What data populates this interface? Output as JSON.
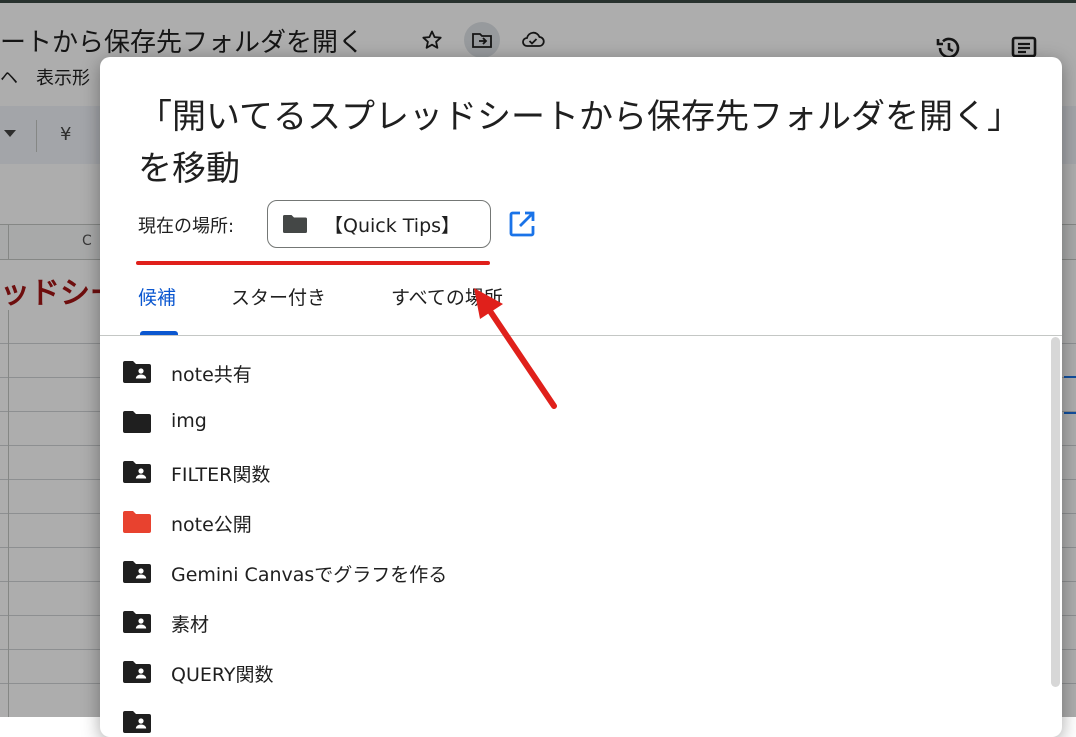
{
  "background": {
    "doc_title": "ートから保存先フォルダを開く",
    "menu_partial": "ヘ　表示形",
    "toolbar_symbol": "¥",
    "column_c": "C",
    "sheet_text": "ッドシー"
  },
  "dialog": {
    "title": "「開いてるスプレッドシートから保存先フォルダを開く」を移動",
    "current_location_label": "現在の場所:",
    "current_location_value": "【Quick Tips】",
    "tabs": [
      {
        "label": "候補"
      },
      {
        "label": "スター付き"
      },
      {
        "label": "すべての場所"
      }
    ],
    "folders": [
      {
        "name": "note共有",
        "icon": "shared-folder-icon",
        "color": "#1f1f1f"
      },
      {
        "name": "img",
        "icon": "folder-icon",
        "color": "#1f1f1f"
      },
      {
        "name": "FILTER関数",
        "icon": "shared-folder-icon",
        "color": "#1f1f1f"
      },
      {
        "name": "note公開",
        "icon": "folder-icon",
        "color": "#e8422f"
      },
      {
        "name": "Gemini Canvasでグラフを作る",
        "icon": "shared-folder-icon",
        "color": "#1f1f1f"
      },
      {
        "name": "素材",
        "icon": "shared-folder-icon",
        "color": "#1f1f1f"
      },
      {
        "name": "QUERY関数",
        "icon": "shared-folder-icon",
        "color": "#1f1f1f"
      },
      {
        "name": "",
        "icon": "shared-folder-icon",
        "color": "#1f1f1f"
      }
    ]
  },
  "colors": {
    "accent": "#0b57d0",
    "annotation": "#e0201b",
    "link_icon": "#1a73e8"
  }
}
